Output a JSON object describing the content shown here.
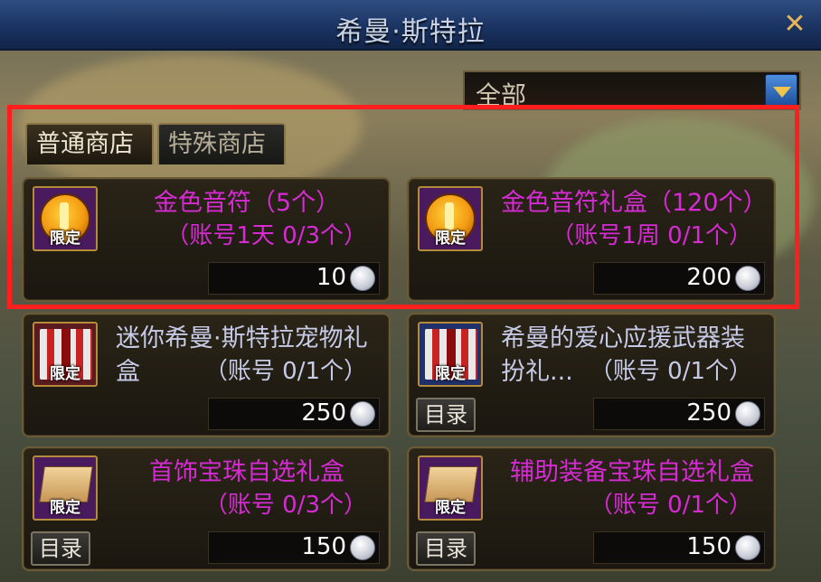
{
  "window": {
    "title": "希曼·斯特拉",
    "close_label": "✕"
  },
  "filter": {
    "selected": "全部"
  },
  "tabs": [
    {
      "label": "普通商店"
    },
    {
      "label": "特殊商店"
    }
  ],
  "items": [
    {
      "name": "金色音符（5个）",
      "limit": "（账号1天 0/3个）",
      "price": "10",
      "badge": "限定",
      "icon": "gold-note-icon"
    },
    {
      "name": "金色音符礼盒（120个）",
      "limit": "（账号1周 0/1个）",
      "price": "200",
      "badge": "限定",
      "icon": "gold-note-icon"
    },
    {
      "name": "迷你希曼·斯特拉宠物礼盒",
      "limit": "（账号 0/1个）",
      "price": "250",
      "badge": "限定",
      "icon": "gift-box-icon"
    },
    {
      "name": "希曼的爱心应援武器装扮礼...",
      "limit": "（账号 0/1个）",
      "price": "250",
      "badge": "限定",
      "icon": "gift-box-icon",
      "button": "目录"
    },
    {
      "name": "首饰宝珠自选礼盒",
      "limit": "（账号 0/3个）",
      "price": "150",
      "badge": "限定",
      "icon": "treasure-box-icon",
      "button": "目录"
    },
    {
      "name": "辅助装备宝珠自选礼盒",
      "limit": "（账号 0/1个）",
      "price": "150",
      "badge": "限定",
      "icon": "treasure-box-icon",
      "button": "目录"
    }
  ]
}
